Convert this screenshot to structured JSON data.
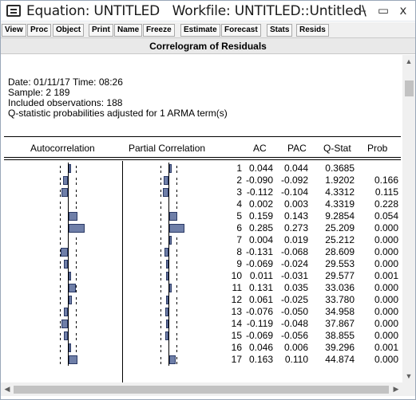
{
  "window": {
    "title": "Equation: UNTITLED   Workfile: UNTITLED::Untitled\\",
    "minimize_label": "–",
    "maximize_label": "▭",
    "close_label": "x"
  },
  "toolbar": {
    "buttons": [
      "View",
      "Proc",
      "Object",
      "Print",
      "Name",
      "Freeze",
      "Estimate",
      "Forecast",
      "Stats",
      "Resids"
    ]
  },
  "view_title": "Correlogram of Residuals",
  "header": {
    "date_line": "Date: 01/11/17   Time: 08:26",
    "sample_line": "Sample: 2 189",
    "obs_line": "Included observations: 188",
    "qstat_line": "Q-statistic probabilities adjusted for 1 ARMA term(s)"
  },
  "table": {
    "columns": [
      "Autocorrelation",
      "Partial Correlation",
      "AC",
      "PAC",
      "Q-Stat",
      "Prob"
    ],
    "rows": [
      {
        "lag": "1",
        "ac": "0.044",
        "pac": "0.044",
        "q": "0.3685",
        "prob": "",
        "ac_v": 0.044,
        "pac_v": 0.044
      },
      {
        "lag": "2",
        "ac": "-0.090",
        "pac": "-0.092",
        "q": "1.9202",
        "prob": "0.166",
        "ac_v": -0.09,
        "pac_v": -0.092
      },
      {
        "lag": "3",
        "ac": "-0.112",
        "pac": "-0.104",
        "q": "4.3312",
        "prob": "0.115",
        "ac_v": -0.112,
        "pac_v": -0.104
      },
      {
        "lag": "4",
        "ac": "0.002",
        "pac": "0.003",
        "q": "4.3319",
        "prob": "0.228",
        "ac_v": 0.002,
        "pac_v": 0.003
      },
      {
        "lag": "5",
        "ac": "0.159",
        "pac": "0.143",
        "q": "9.2854",
        "prob": "0.054",
        "ac_v": 0.159,
        "pac_v": 0.143
      },
      {
        "lag": "6",
        "ac": "0.285",
        "pac": "0.273",
        "q": "25.209",
        "prob": "0.000",
        "ac_v": 0.285,
        "pac_v": 0.273
      },
      {
        "lag": "7",
        "ac": "0.004",
        "pac": "0.019",
        "q": "25.212",
        "prob": "0.000",
        "ac_v": 0.004,
        "pac_v": 0.019
      },
      {
        "lag": "8",
        "ac": "-0.131",
        "pac": "-0.068",
        "q": "28.609",
        "prob": "0.000",
        "ac_v": -0.131,
        "pac_v": -0.068
      },
      {
        "lag": "9",
        "ac": "-0.069",
        "pac": "-0.024",
        "q": "29.553",
        "prob": "0.000",
        "ac_v": -0.069,
        "pac_v": -0.024
      },
      {
        "lag": "10",
        "ac": "0.011",
        "pac": "-0.031",
        "q": "29.577",
        "prob": "0.001",
        "ac_v": 0.011,
        "pac_v": -0.031
      },
      {
        "lag": "11",
        "ac": "0.131",
        "pac": "0.035",
        "q": "33.036",
        "prob": "0.000",
        "ac_v": 0.131,
        "pac_v": 0.035
      },
      {
        "lag": "12",
        "ac": "0.061",
        "pac": "-0.025",
        "q": "33.780",
        "prob": "0.000",
        "ac_v": 0.061,
        "pac_v": -0.025
      },
      {
        "lag": "13",
        "ac": "-0.076",
        "pac": "-0.050",
        "q": "34.958",
        "prob": "0.000",
        "ac_v": -0.076,
        "pac_v": -0.05
      },
      {
        "lag": "14",
        "ac": "-0.119",
        "pac": "-0.048",
        "q": "37.867",
        "prob": "0.000",
        "ac_v": -0.119,
        "pac_v": -0.048
      },
      {
        "lag": "15",
        "ac": "-0.069",
        "pac": "-0.056",
        "q": "38.855",
        "prob": "0.000",
        "ac_v": -0.069,
        "pac_v": -0.056
      },
      {
        "lag": "16",
        "ac": "0.046",
        "pac": "0.006",
        "q": "39.296",
        "prob": "0.001",
        "ac_v": 0.046,
        "pac_v": 0.006
      },
      {
        "lag": "17",
        "ac": "0.163",
        "pac": "0.110",
        "q": "44.874",
        "prob": "0.000",
        "ac_v": 0.163,
        "pac_v": 0.11
      }
    ]
  },
  "icons": {
    "app": "equation-window-icon",
    "scroll_up": "▲",
    "scroll_down": "▼",
    "scroll_left": "◀",
    "scroll_right": "▶"
  },
  "colors": {
    "bar_fill": "#6f7fa8",
    "bar_border": "#2b3a66",
    "toolbar_bg": "#f0f0f0"
  }
}
